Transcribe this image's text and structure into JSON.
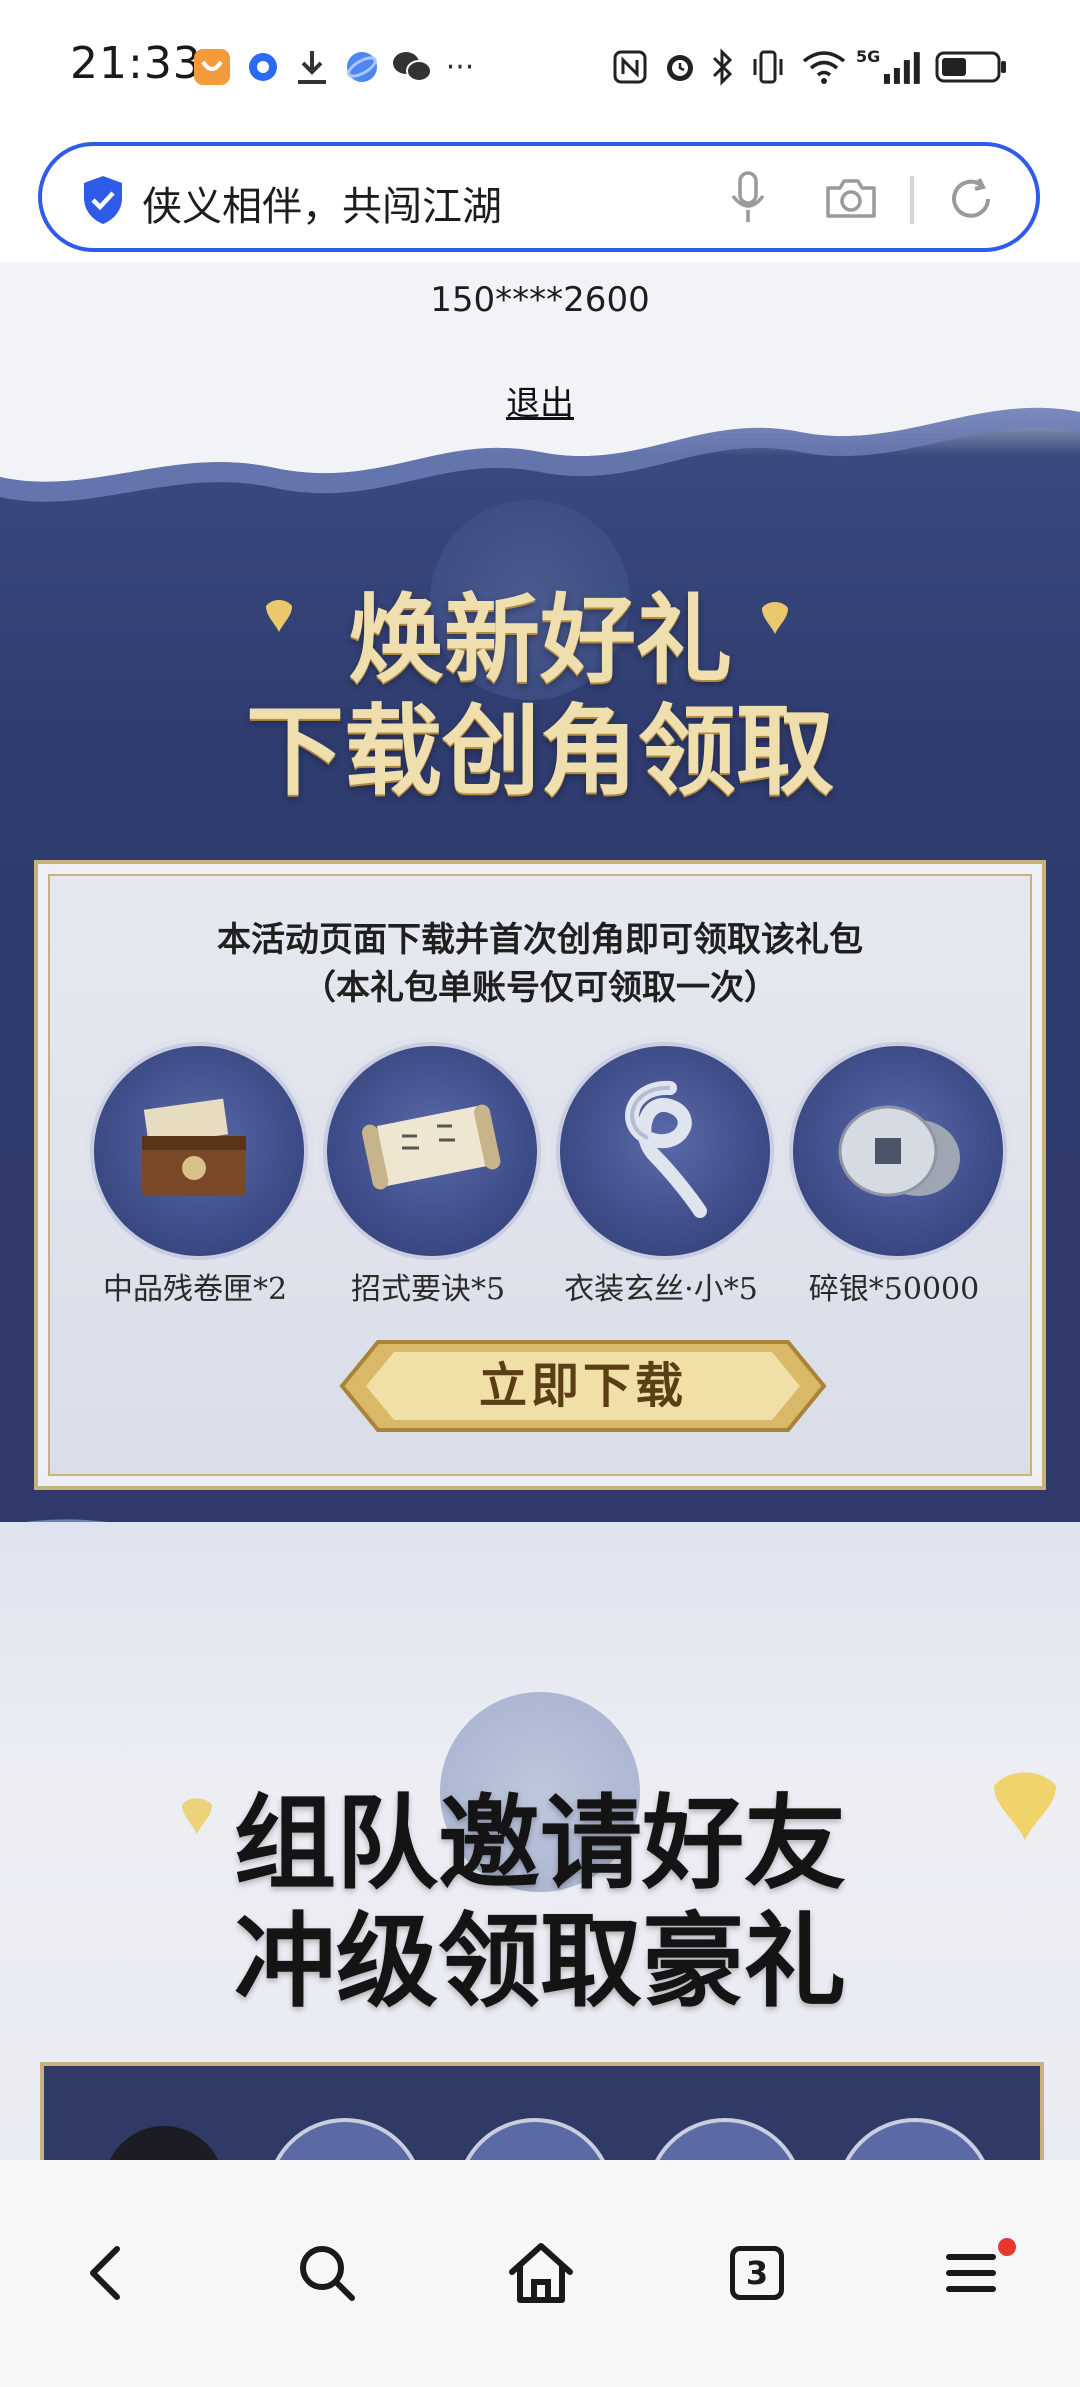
{
  "status_bar": {
    "time": "21:33",
    "icons": [
      "app-badge-icon",
      "circle-app-icon",
      "download-icon",
      "browser-icon",
      "wechat-icon",
      "more-dots-icon",
      "nfc-icon",
      "alarm-icon",
      "bluetooth-icon",
      "vibrate-icon",
      "wifi-icon",
      "5g-signal-icon",
      "battery-icon"
    ],
    "network_label": "5G"
  },
  "search_bar": {
    "query": "侠义相伴，共闯江湖",
    "icons": [
      "shield-check-icon",
      "microphone-icon",
      "camera-icon",
      "refresh-icon"
    ]
  },
  "page": {
    "account_phone": "150****2600",
    "logout_label": "退出",
    "section1": {
      "title_line1": "焕新好礼",
      "title_line2": "下载创角领取",
      "desc_line1": "本活动页面下载并首次创角即可领取该礼包",
      "desc_line2": "（本礼包单账号仅可领取一次）",
      "gifts": [
        {
          "label": "中品残卷匣*2",
          "icon": "treasure-chest-icon"
        },
        {
          "label": "招式要诀*5",
          "icon": "scroll-icon"
        },
        {
          "label": "衣装玄丝·小*5",
          "icon": "silk-ribbon-icon"
        },
        {
          "label": "碎银*50000",
          "icon": "silver-coins-icon"
        }
      ],
      "download_button": "立即下载"
    },
    "section2": {
      "title_line1": "组队邀请好友",
      "title_line2": "冲级领取豪礼"
    }
  },
  "nav_bar": {
    "back": "back-icon",
    "search": "search-icon",
    "home": "home-icon",
    "tabs_count": "3",
    "menu": "menu-icon"
  },
  "colors": {
    "accent_blue": "#2f5bea",
    "navy": "#2f3a6b",
    "gold": "#f0dfae",
    "notification_red": "#e8372d"
  }
}
